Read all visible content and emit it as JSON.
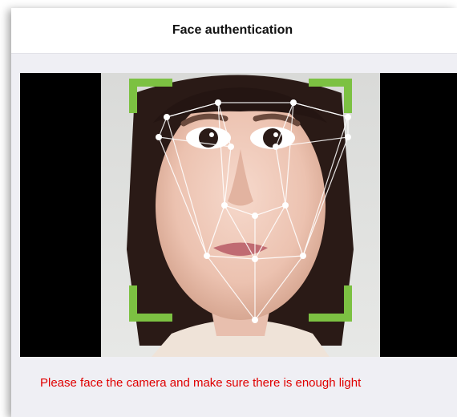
{
  "header": {
    "title": "Face authentication"
  },
  "camera": {
    "frame_color": "#7cc142",
    "landmark_color": "#ffffff"
  },
  "message": {
    "text": "Please face the camera and make sure there is enough light",
    "color": "#e00000"
  }
}
